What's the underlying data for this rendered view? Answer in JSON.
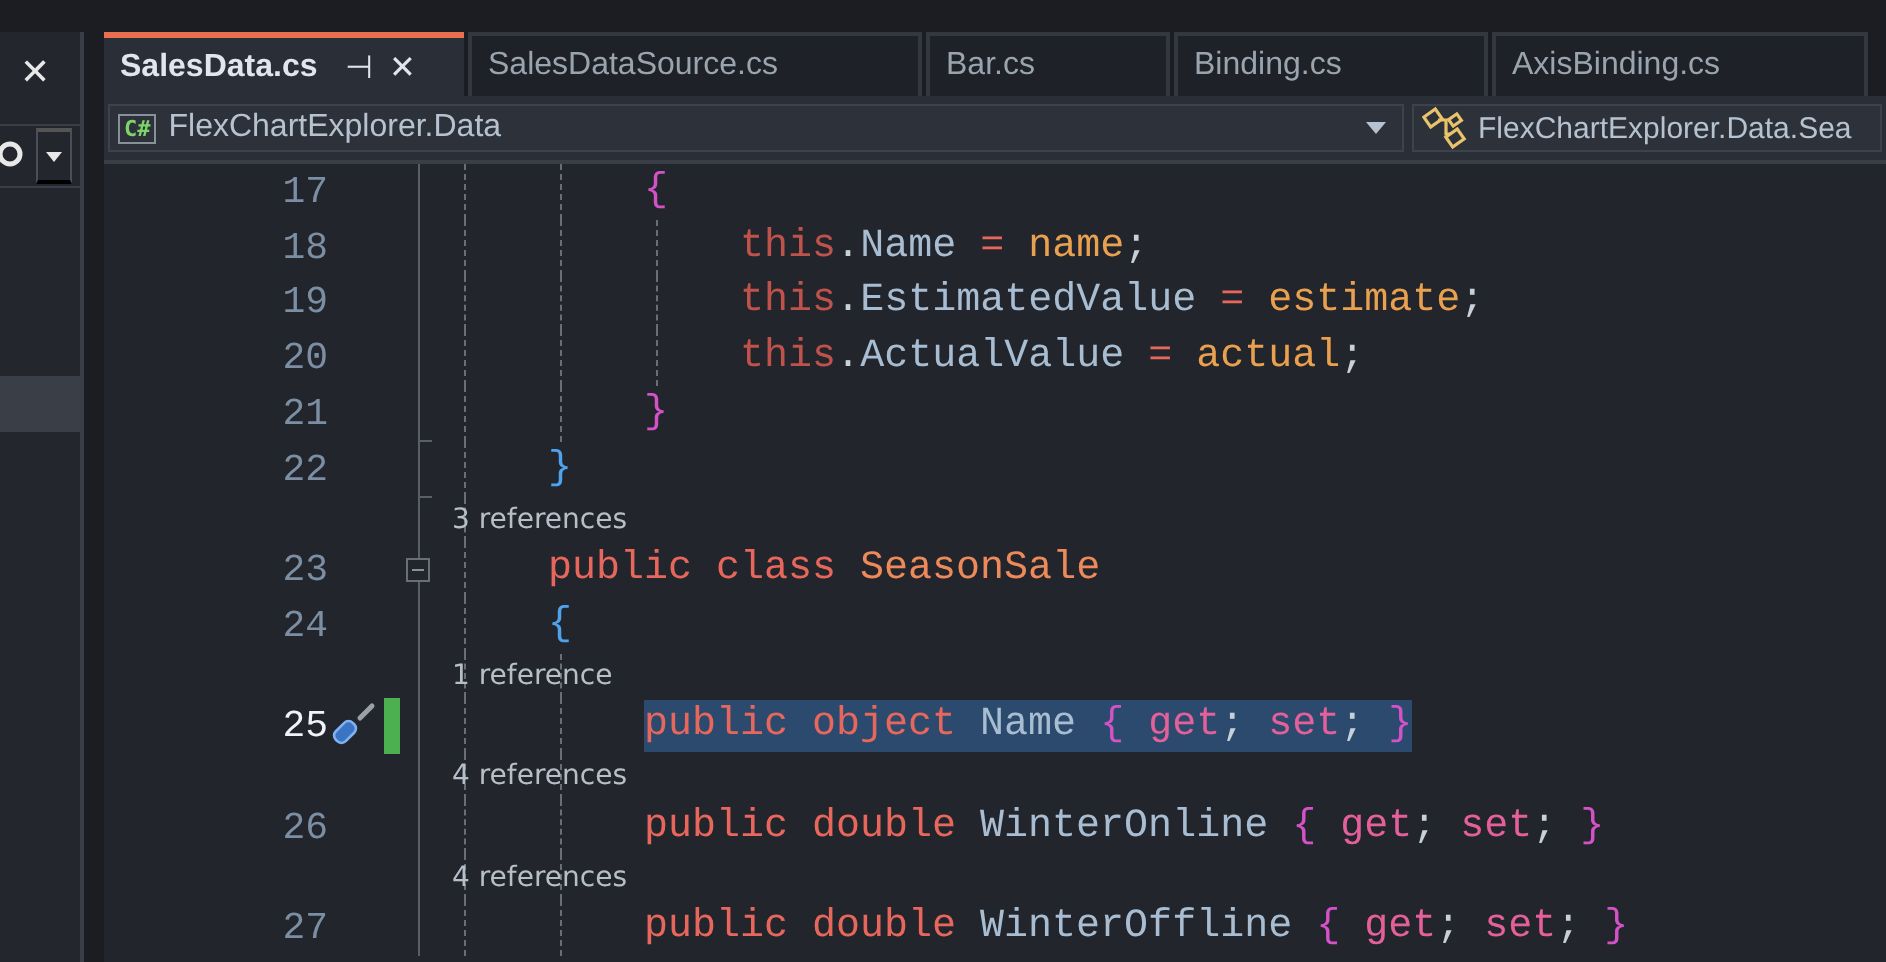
{
  "side_panel": {
    "close": "✕"
  },
  "tabs": [
    {
      "label": "SalesData.cs",
      "selected": true,
      "pin": "⊣",
      "close": "✕"
    },
    {
      "label": "SalesDataSource.cs",
      "selected": false
    },
    {
      "label": "Bar.cs",
      "selected": false
    },
    {
      "label": "Binding.cs",
      "selected": false
    },
    {
      "label": "AxisBinding.cs",
      "selected": false
    }
  ],
  "navigation": {
    "project": "FlexChartExplorer.Data",
    "project_badge": "C#",
    "type": "FlexChartExplorer.Data.Sea"
  },
  "lines": [
    {
      "number": "17",
      "current": false,
      "modified": false,
      "quick_action": false,
      "collapsible": false,
      "block_end": false,
      "selected": false,
      "tokens": [
        {
          "kind": "brace_a",
          "text": "        {"
        }
      ]
    },
    {
      "number": "18",
      "current": false,
      "modified": false,
      "quick_action": false,
      "collapsible": false,
      "block_end": false,
      "selected": false,
      "tokens": [
        {
          "kind": "this",
          "text": "            this"
        },
        {
          "kind": "punct",
          "text": "."
        },
        {
          "kind": "ident",
          "text": "Name"
        },
        {
          "kind": "op",
          "text": " = "
        },
        {
          "kind": "param",
          "text": "name"
        },
        {
          "kind": "punct",
          "text": ";"
        }
      ]
    },
    {
      "number": "19",
      "current": false,
      "modified": false,
      "quick_action": false,
      "collapsible": false,
      "block_end": false,
      "selected": false,
      "tokens": [
        {
          "kind": "this",
          "text": "            this"
        },
        {
          "kind": "punct",
          "text": "."
        },
        {
          "kind": "ident",
          "text": "EstimatedValue"
        },
        {
          "kind": "op",
          "text": " = "
        },
        {
          "kind": "param",
          "text": "estimate"
        },
        {
          "kind": "punct",
          "text": ";"
        }
      ]
    },
    {
      "number": "20",
      "current": false,
      "modified": false,
      "quick_action": false,
      "collapsible": false,
      "block_end": false,
      "selected": false,
      "tokens": [
        {
          "kind": "this",
          "text": "            this"
        },
        {
          "kind": "punct",
          "text": "."
        },
        {
          "kind": "ident",
          "text": "ActualValue"
        },
        {
          "kind": "op",
          "text": " = "
        },
        {
          "kind": "param",
          "text": "actual"
        },
        {
          "kind": "punct",
          "text": ";"
        }
      ]
    },
    {
      "number": "21",
      "current": false,
      "modified": false,
      "quick_action": false,
      "collapsible": false,
      "block_end": true,
      "selected": false,
      "tokens": [
        {
          "kind": "brace_a",
          "text": "        }"
        }
      ]
    },
    {
      "number": "22",
      "current": false,
      "modified": false,
      "quick_action": false,
      "collapsible": false,
      "block_end": true,
      "selected": false,
      "tokens": [
        {
          "kind": "brace_b",
          "text": "    }"
        }
      ]
    },
    {
      "number": "23",
      "codelens": "3 references",
      "current": false,
      "modified": false,
      "quick_action": false,
      "collapsible": true,
      "block_end": false,
      "selected": false,
      "tokens": [
        {
          "kind": "keyword",
          "text": "    public "
        },
        {
          "kind": "keyword",
          "text": "class "
        },
        {
          "kind": "type_name",
          "text": "SeasonSale"
        }
      ]
    },
    {
      "number": "24",
      "current": false,
      "modified": false,
      "quick_action": false,
      "collapsible": false,
      "block_end": false,
      "selected": false,
      "tokens": [
        {
          "kind": "brace_b",
          "text": "    {"
        }
      ]
    },
    {
      "number": "25",
      "codelens": "1 reference",
      "current": true,
      "modified": true,
      "quick_action": true,
      "collapsible": false,
      "block_end": false,
      "selected": true,
      "tokens": [
        {
          "kind": "keyword",
          "text": "        public "
        },
        {
          "kind": "keyword",
          "text": "object "
        },
        {
          "kind": "ident",
          "text": "Name "
        },
        {
          "kind": "brace_a",
          "text": "{ "
        },
        {
          "kind": "accessor",
          "text": "get"
        },
        {
          "kind": "punct",
          "text": "; "
        },
        {
          "kind": "accessor",
          "text": "set"
        },
        {
          "kind": "punct",
          "text": "; "
        },
        {
          "kind": "brace_a",
          "text": "}"
        }
      ]
    },
    {
      "number": "26",
      "codelens": "4 references",
      "current": false,
      "modified": false,
      "quick_action": false,
      "collapsible": false,
      "block_end": false,
      "selected": false,
      "tokens": [
        {
          "kind": "keyword",
          "text": "        public "
        },
        {
          "kind": "keyword",
          "text": "double "
        },
        {
          "kind": "ident",
          "text": "WinterOnline "
        },
        {
          "kind": "brace_a",
          "text": "{ "
        },
        {
          "kind": "accessor",
          "text": "get"
        },
        {
          "kind": "punct",
          "text": "; "
        },
        {
          "kind": "accessor",
          "text": "set"
        },
        {
          "kind": "punct",
          "text": "; "
        },
        {
          "kind": "brace_a",
          "text": "}"
        }
      ]
    },
    {
      "number": "27",
      "codelens": "4 references",
      "current": false,
      "modified": false,
      "quick_action": false,
      "collapsible": false,
      "block_end": false,
      "selected": false,
      "tokens": [
        {
          "kind": "keyword",
          "text": "        public "
        },
        {
          "kind": "keyword",
          "text": "double "
        },
        {
          "kind": "ident",
          "text": "WinterOffline "
        },
        {
          "kind": "brace_a",
          "text": "{ "
        },
        {
          "kind": "accessor",
          "text": "get"
        },
        {
          "kind": "punct",
          "text": "; "
        },
        {
          "kind": "accessor",
          "text": "set"
        },
        {
          "kind": "punct",
          "text": "; "
        },
        {
          "kind": "brace_a",
          "text": "}"
        }
      ]
    }
  ]
}
